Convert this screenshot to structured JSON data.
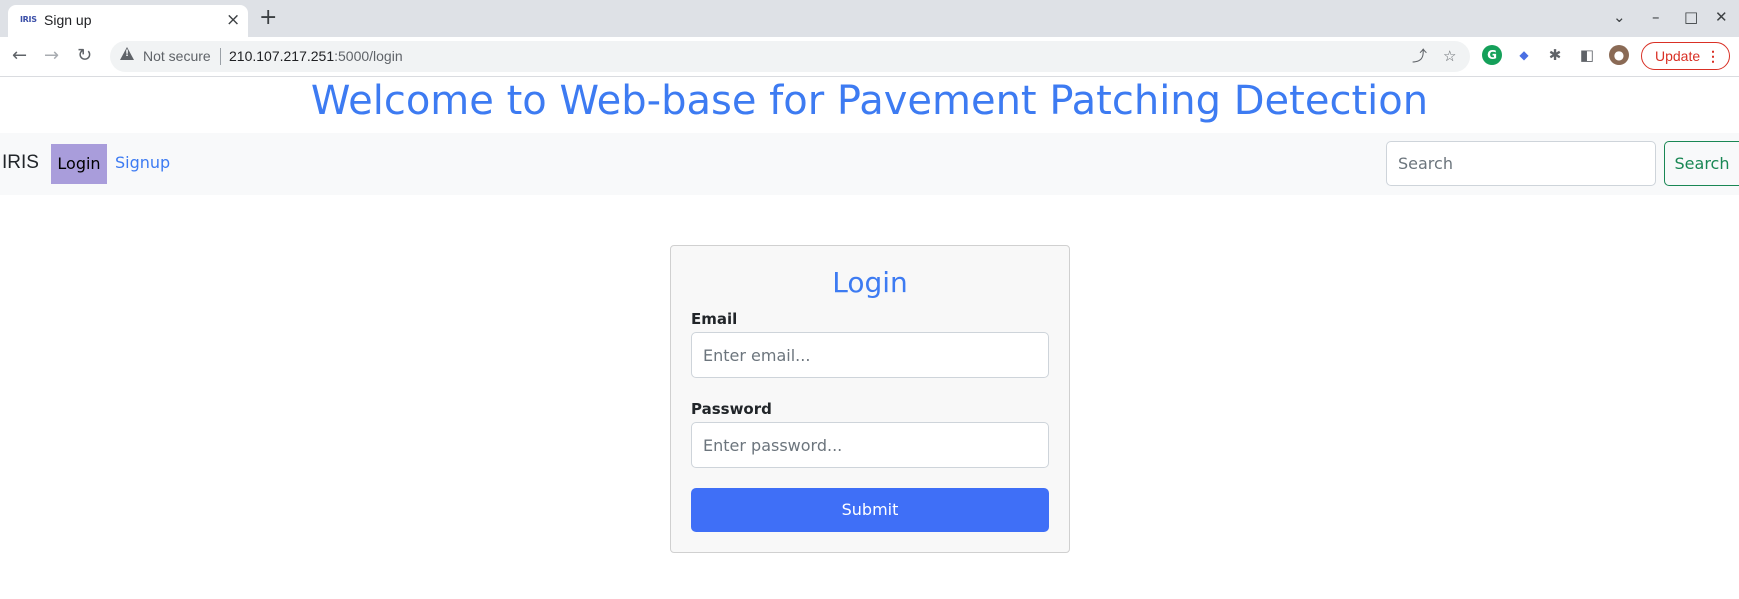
{
  "browser": {
    "tab_favicon": "IRIS",
    "tab_title": "Sign up",
    "tab_close": "×",
    "new_tab": "+",
    "security_label": "Not secure",
    "url_host": "210.107.217.251",
    "url_rest": ":5000/login",
    "update_label": "Update",
    "update_menu": "⋮",
    "icons": {
      "back": "arrow-left-icon",
      "forward": "arrow-right-icon",
      "reload": "reload-icon",
      "share": "share-icon",
      "bookmark": "star-icon",
      "extensions": "puzzle-icon",
      "sidepanel": "side-panel-icon"
    }
  },
  "page": {
    "heading": "Welcome to Web-base for Pavement Patching Detection"
  },
  "navbar": {
    "brand": "IRIS",
    "login": "Login",
    "signup": "Signup",
    "search_placeholder": "Search",
    "search_button": "Search"
  },
  "login_form": {
    "title": "Login",
    "email_label": "Email",
    "email_placeholder": "Enter email...",
    "password_label": "Password",
    "password_placeholder": "Enter password...",
    "submit": "Submit"
  },
  "colors": {
    "accent": "#3d7bf2",
    "submit_bg": "#3f6ff7",
    "active_nav_bg": "#a99ddb",
    "search_button": "#198754",
    "update_red": "#d93025"
  }
}
